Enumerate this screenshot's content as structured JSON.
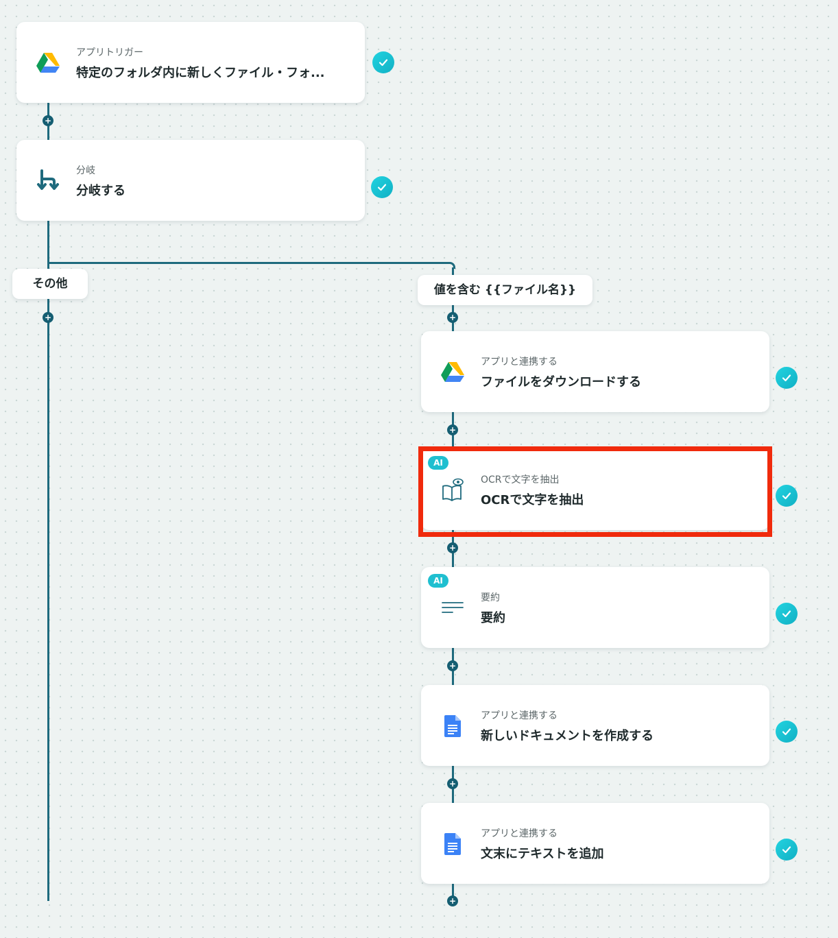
{
  "colors": {
    "line": "#1e6a7d",
    "check": "#22d3e0",
    "ai_badge": "#1fbfd0",
    "highlight": "#f02a0c"
  },
  "trigger": {
    "icon": "google-drive-icon",
    "subtitle": "アプリトリガー",
    "title": "特定のフォルダ内に新しくファイル・フォ..."
  },
  "branch_step": {
    "icon": "branch-icon",
    "subtitle": "分岐",
    "title": "分岐する"
  },
  "branches": {
    "other_label": "その他",
    "condition_label": "値を含む {{ファイル名}}"
  },
  "steps": [
    {
      "icon": "google-drive-icon",
      "subtitle": "アプリと連携する",
      "title": "ファイルをダウンロードする",
      "ai": false
    },
    {
      "icon": "ocr-book-eye-icon",
      "subtitle": "OCRで文字を抽出",
      "title": "OCRで文字を抽出",
      "ai": true,
      "ai_label": "AI",
      "highlighted": true
    },
    {
      "icon": "summary-lines-icon",
      "subtitle": "要約",
      "title": "要約",
      "ai": true,
      "ai_label": "AI"
    },
    {
      "icon": "google-docs-icon",
      "subtitle": "アプリと連携する",
      "title": "新しいドキュメントを作成する",
      "ai": false
    },
    {
      "icon": "google-docs-icon",
      "subtitle": "アプリと連携する",
      "title": "文末にテキストを追加",
      "ai": false
    }
  ]
}
